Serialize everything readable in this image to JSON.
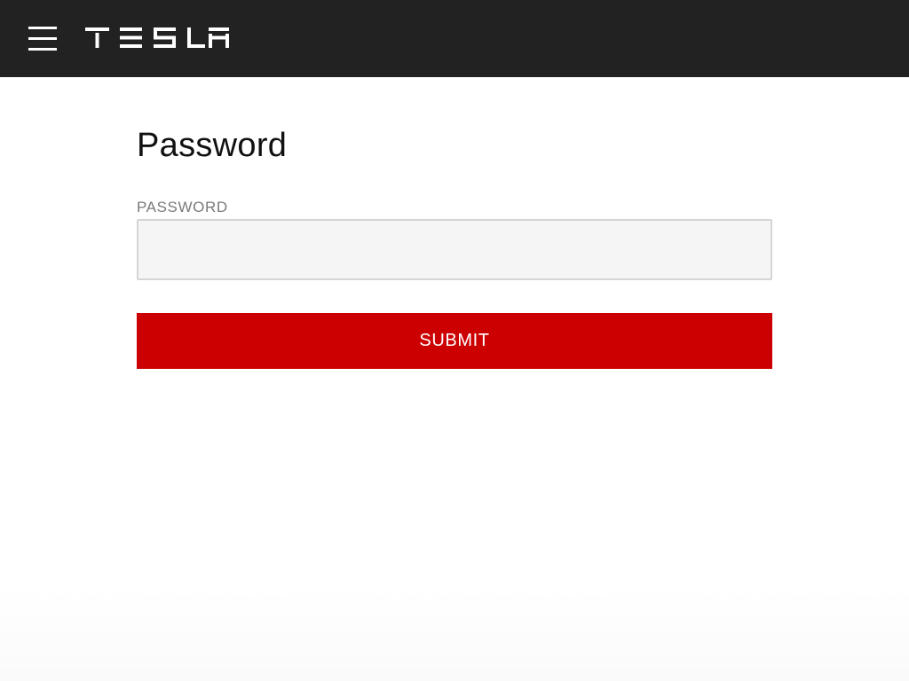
{
  "header": {
    "background_color": "#222222",
    "menu_icon": "hamburger-menu-icon",
    "logo_text": "TESLA"
  },
  "main": {
    "title": "Password",
    "password_field": {
      "label": "PASSWORD",
      "value": "",
      "placeholder": ""
    },
    "submit_label": "SUBMIT",
    "submit_color": "#cc0000"
  }
}
